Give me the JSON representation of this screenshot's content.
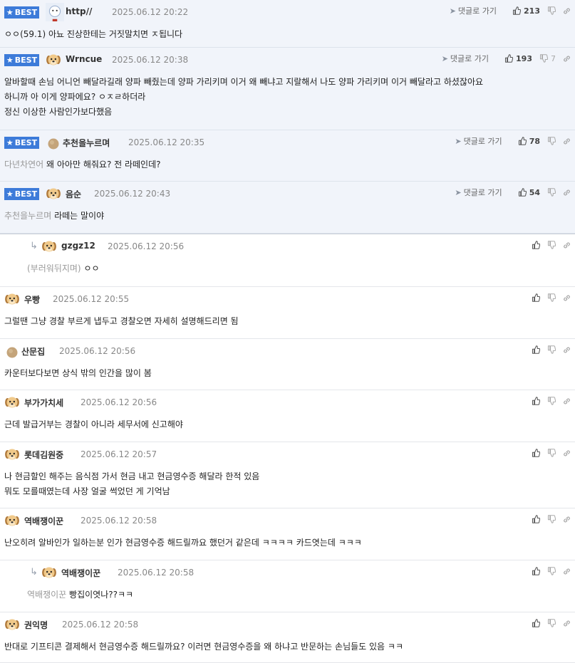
{
  "comments": [
    {
      "type": "best",
      "avatar": "profile-image",
      "nickname": "http//",
      "date": "2025.06.12 20:22",
      "reply_label": "댓글로 가기",
      "likes": "213",
      "dislikes": "",
      "mention": "",
      "text": "ㅇㅇ(59.1) 아뇨 진상한테는 거짓말치면 ㅈ됩니다"
    },
    {
      "type": "best",
      "avatar": "dog",
      "nickname": "Wrncue",
      "date": "2025.06.12 20:38",
      "reply_label": "댓글로 가기",
      "likes": "193",
      "dislikes": "7",
      "mention": "",
      "text": "알바할때 손님 어니언 빼달라길래 양파 빼줬는데 양파 가리키며 이거 왜 빼냐고 지랄해서 나도 양파 가리키며 이거 빼달라고 하셨잖아요\n하니까 아 이게 양파에요? ㅇㅈㄹ하더라\n정신 이상한 사람인가보다했음"
    },
    {
      "type": "best",
      "avatar": "ball",
      "nickname": "추천을누르며",
      "date": "2025.06.12 20:35",
      "reply_label": "댓글로 가기",
      "likes": "78",
      "dislikes": "",
      "mention": "다년차연어",
      "text": "왜 아아만 해줘요? 전 라떼인데?"
    },
    {
      "type": "best",
      "avatar": "dog",
      "nickname": "음순",
      "date": "2025.06.12 20:43",
      "reply_label": "댓글로 가기",
      "likes": "54",
      "dislikes": "",
      "mention": "추천을누르며",
      "text": "라떼는 말이야"
    },
    {
      "type": "reply",
      "avatar": "dog",
      "nickname": "gzgz12",
      "date": "2025.06.12 20:56",
      "mention": "(부러워뒤지며)",
      "text": "ㅇㅇ"
    },
    {
      "type": "normal",
      "avatar": "dog",
      "nickname": "우빵",
      "date": "2025.06.12 20:55",
      "mention": "",
      "text": "그럴땐 그냥 경찰 부르게 냅두고 경찰오면 자세히 설명해드리면 됨"
    },
    {
      "type": "normal",
      "avatar": "ball",
      "nickname": "산문집",
      "date": "2025.06.12 20:56",
      "mention": "",
      "text": "카운터보다보면 상식 밖의 인간을 많이 봄"
    },
    {
      "type": "normal",
      "avatar": "dog",
      "nickname": "부가가치세",
      "date": "2025.06.12 20:56",
      "mention": "",
      "text": "근데 발급거부는 경찰이 아니라 세무서에 신고해야"
    },
    {
      "type": "normal",
      "avatar": "dog",
      "nickname": "롯데김원중",
      "date": "2025.06.12 20:57",
      "mention": "",
      "text": "나 현금할인 해주는 음식점 가서 현금 내고 현금영수증 해달라 한적 있음\n뭐도 모를때였는데 사장 얼굴 썩었던 게 기억남"
    },
    {
      "type": "normal",
      "avatar": "dog",
      "nickname": "역배쟁이꾼",
      "date": "2025.06.12 20:58",
      "mention": "",
      "text": "난오히려 알바인가 일하는분 인가 현금영수증 해드릴까요 했던거 같은데 ㅋㅋㅋㅋ 카드엿는데 ㅋㅋㅋ"
    },
    {
      "type": "reply",
      "avatar": "dog",
      "nickname": "역배쟁이꾼",
      "date": "2025.06.12 20:58",
      "mention": "역배쟁이꾼",
      "text": "빵집이엿나??ㅋㅋ"
    },
    {
      "type": "normal",
      "avatar": "dog",
      "nickname": "권익명",
      "date": "2025.06.12 20:58",
      "mention": "",
      "text": "반대로 기프티콘 결제해서 현금영수증 해드릴까요? 이러면 현금영수증을 왜 하냐고 반문하는 손님들도 있음 ㅋㅋ"
    }
  ],
  "best_label": "BEST"
}
